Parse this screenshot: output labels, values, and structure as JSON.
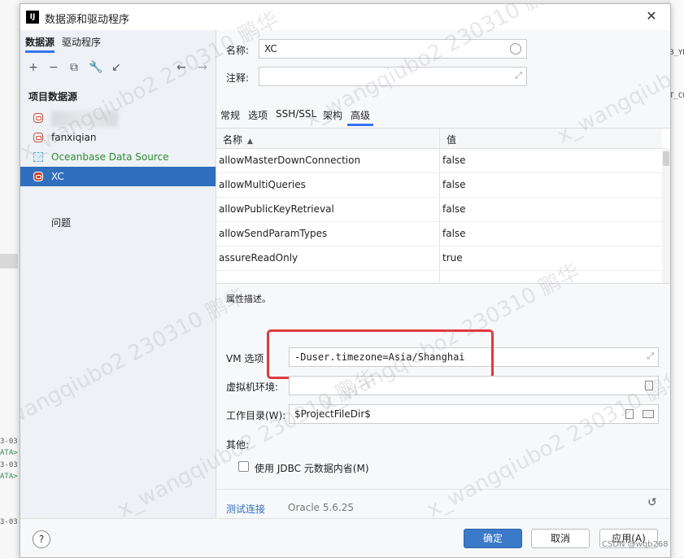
{
  "window": {
    "title": "数据源和驱动程序",
    "app_icon": "IJ"
  },
  "left": {
    "tabs": [
      "数据源",
      "驱动程序"
    ],
    "toolbar_icons": [
      "add-icon",
      "remove-icon",
      "duplicate-icon",
      "wrench-icon",
      "import-icon",
      "back-icon",
      "forward-icon"
    ],
    "section": "项目数据源",
    "items": [
      {
        "label": "",
        "icon": "oracle-icon",
        "blurred": true
      },
      {
        "label": "fanxiqian",
        "icon": "oracle-icon"
      },
      {
        "label": "Oceanbase Data Source",
        "icon": "oceanbase-icon",
        "color": "#2e8b2e"
      },
      {
        "label": "XC",
        "icon": "oracle-icon",
        "selected": true
      }
    ],
    "problems": "问题"
  },
  "form": {
    "name_label": "名称:",
    "name_value": "XC",
    "comment_label": "注释:",
    "comment_value": "",
    "tabs": [
      "常规",
      "选项",
      "SSH/SSL",
      "架构",
      "高级"
    ],
    "active_tab": "高级"
  },
  "table": {
    "headers": [
      "名称",
      "值"
    ],
    "rows": [
      [
        "allowMasterDownConnection",
        "false"
      ],
      [
        "allowMultiQueries",
        "false"
      ],
      [
        "allowPublicKeyRetrieval",
        "false"
      ],
      [
        "allowSendParamTypes",
        "false"
      ],
      [
        "assureReadOnly",
        "true"
      ]
    ]
  },
  "advanced": {
    "description": "属性描述。",
    "vm_label": "VM 选项",
    "vm_value": "-Duser.timezone=Asia/Shanghai",
    "env_label": "虚拟机环境:",
    "env_value": "",
    "workdir_label": "工作目录(W):",
    "workdir_value": "$ProjectFileDir$",
    "other_label": "其他:",
    "jdbc_checkbox_label": "使用 JDBC 元数据内省(M)",
    "jdbc_checked": false
  },
  "footer": {
    "test_link": "测试连接",
    "driver_info": "Oracle 5.6.25"
  },
  "buttons": {
    "ok": "确定",
    "cancel": "取消",
    "apply": "应用(A)",
    "help": "?"
  },
  "watermark": "x_wangqiubo2 230310 鹏华",
  "csdn": "CSDN @wqb268",
  "colors": {
    "accent": "#3574f0",
    "selection": "#2f6fbd",
    "oracle": "#c74634",
    "highlight": "#e0393e"
  }
}
